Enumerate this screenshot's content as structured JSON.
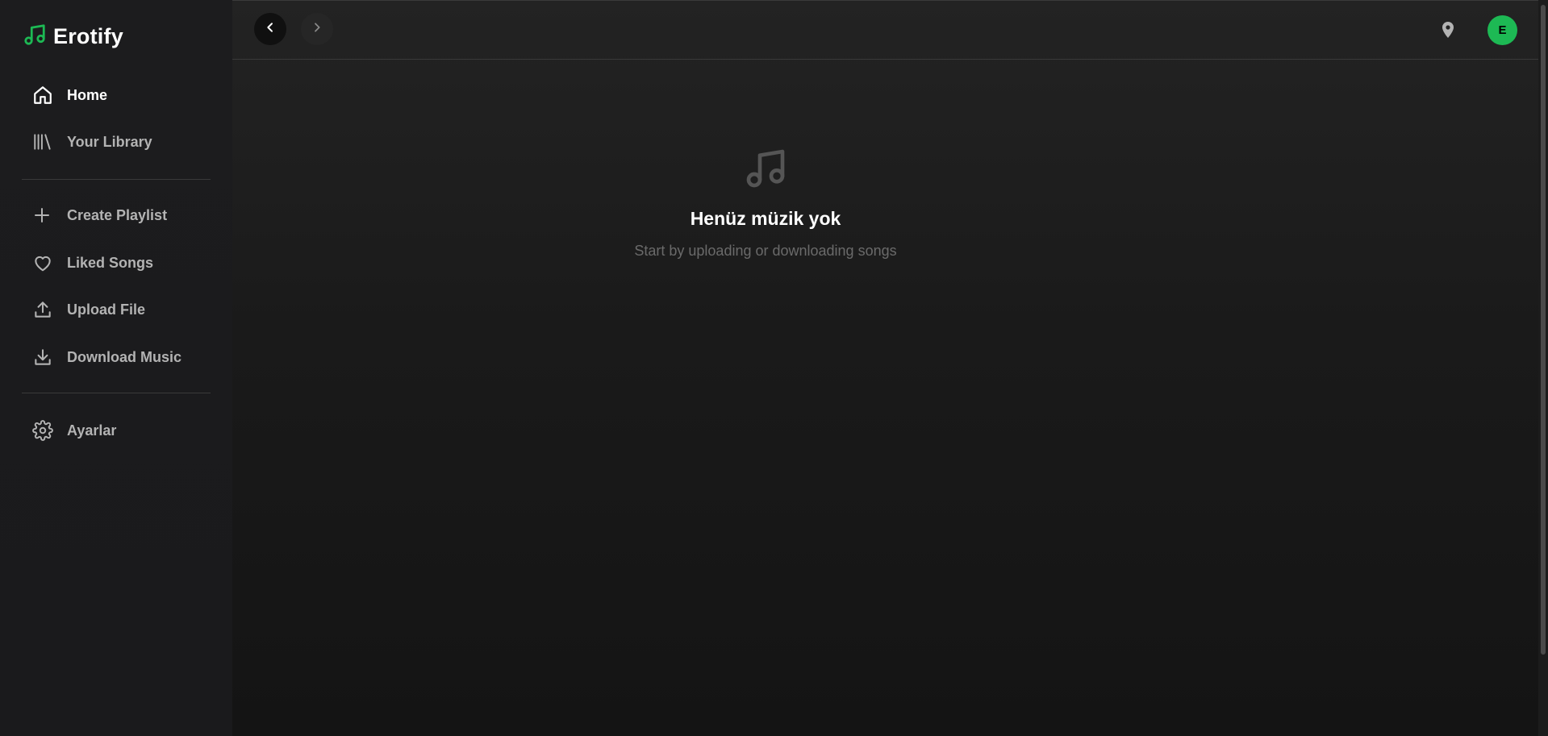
{
  "app": {
    "name": "Erotify"
  },
  "colors": {
    "accent": "#1db954",
    "sidebar_bg": "#1c1c1e",
    "main_bg": "#1a1a1a"
  },
  "sidebar": {
    "primary": [
      {
        "label": "Home",
        "icon": "home-icon",
        "active": true
      },
      {
        "label": "Your Library",
        "icon": "library-icon",
        "active": false
      }
    ],
    "actions": [
      {
        "label": "Create Playlist",
        "icon": "plus-icon"
      },
      {
        "label": "Liked Songs",
        "icon": "heart-icon"
      },
      {
        "label": "Upload File",
        "icon": "upload-icon"
      },
      {
        "label": "Download Music",
        "icon": "download-icon"
      }
    ],
    "settings": {
      "label": "Ayarlar",
      "icon": "gear-icon"
    }
  },
  "topbar": {
    "avatar_initial": "E"
  },
  "empty_state": {
    "title": "Henüz müzik yok",
    "subtitle": "Start by uploading or downloading songs"
  }
}
